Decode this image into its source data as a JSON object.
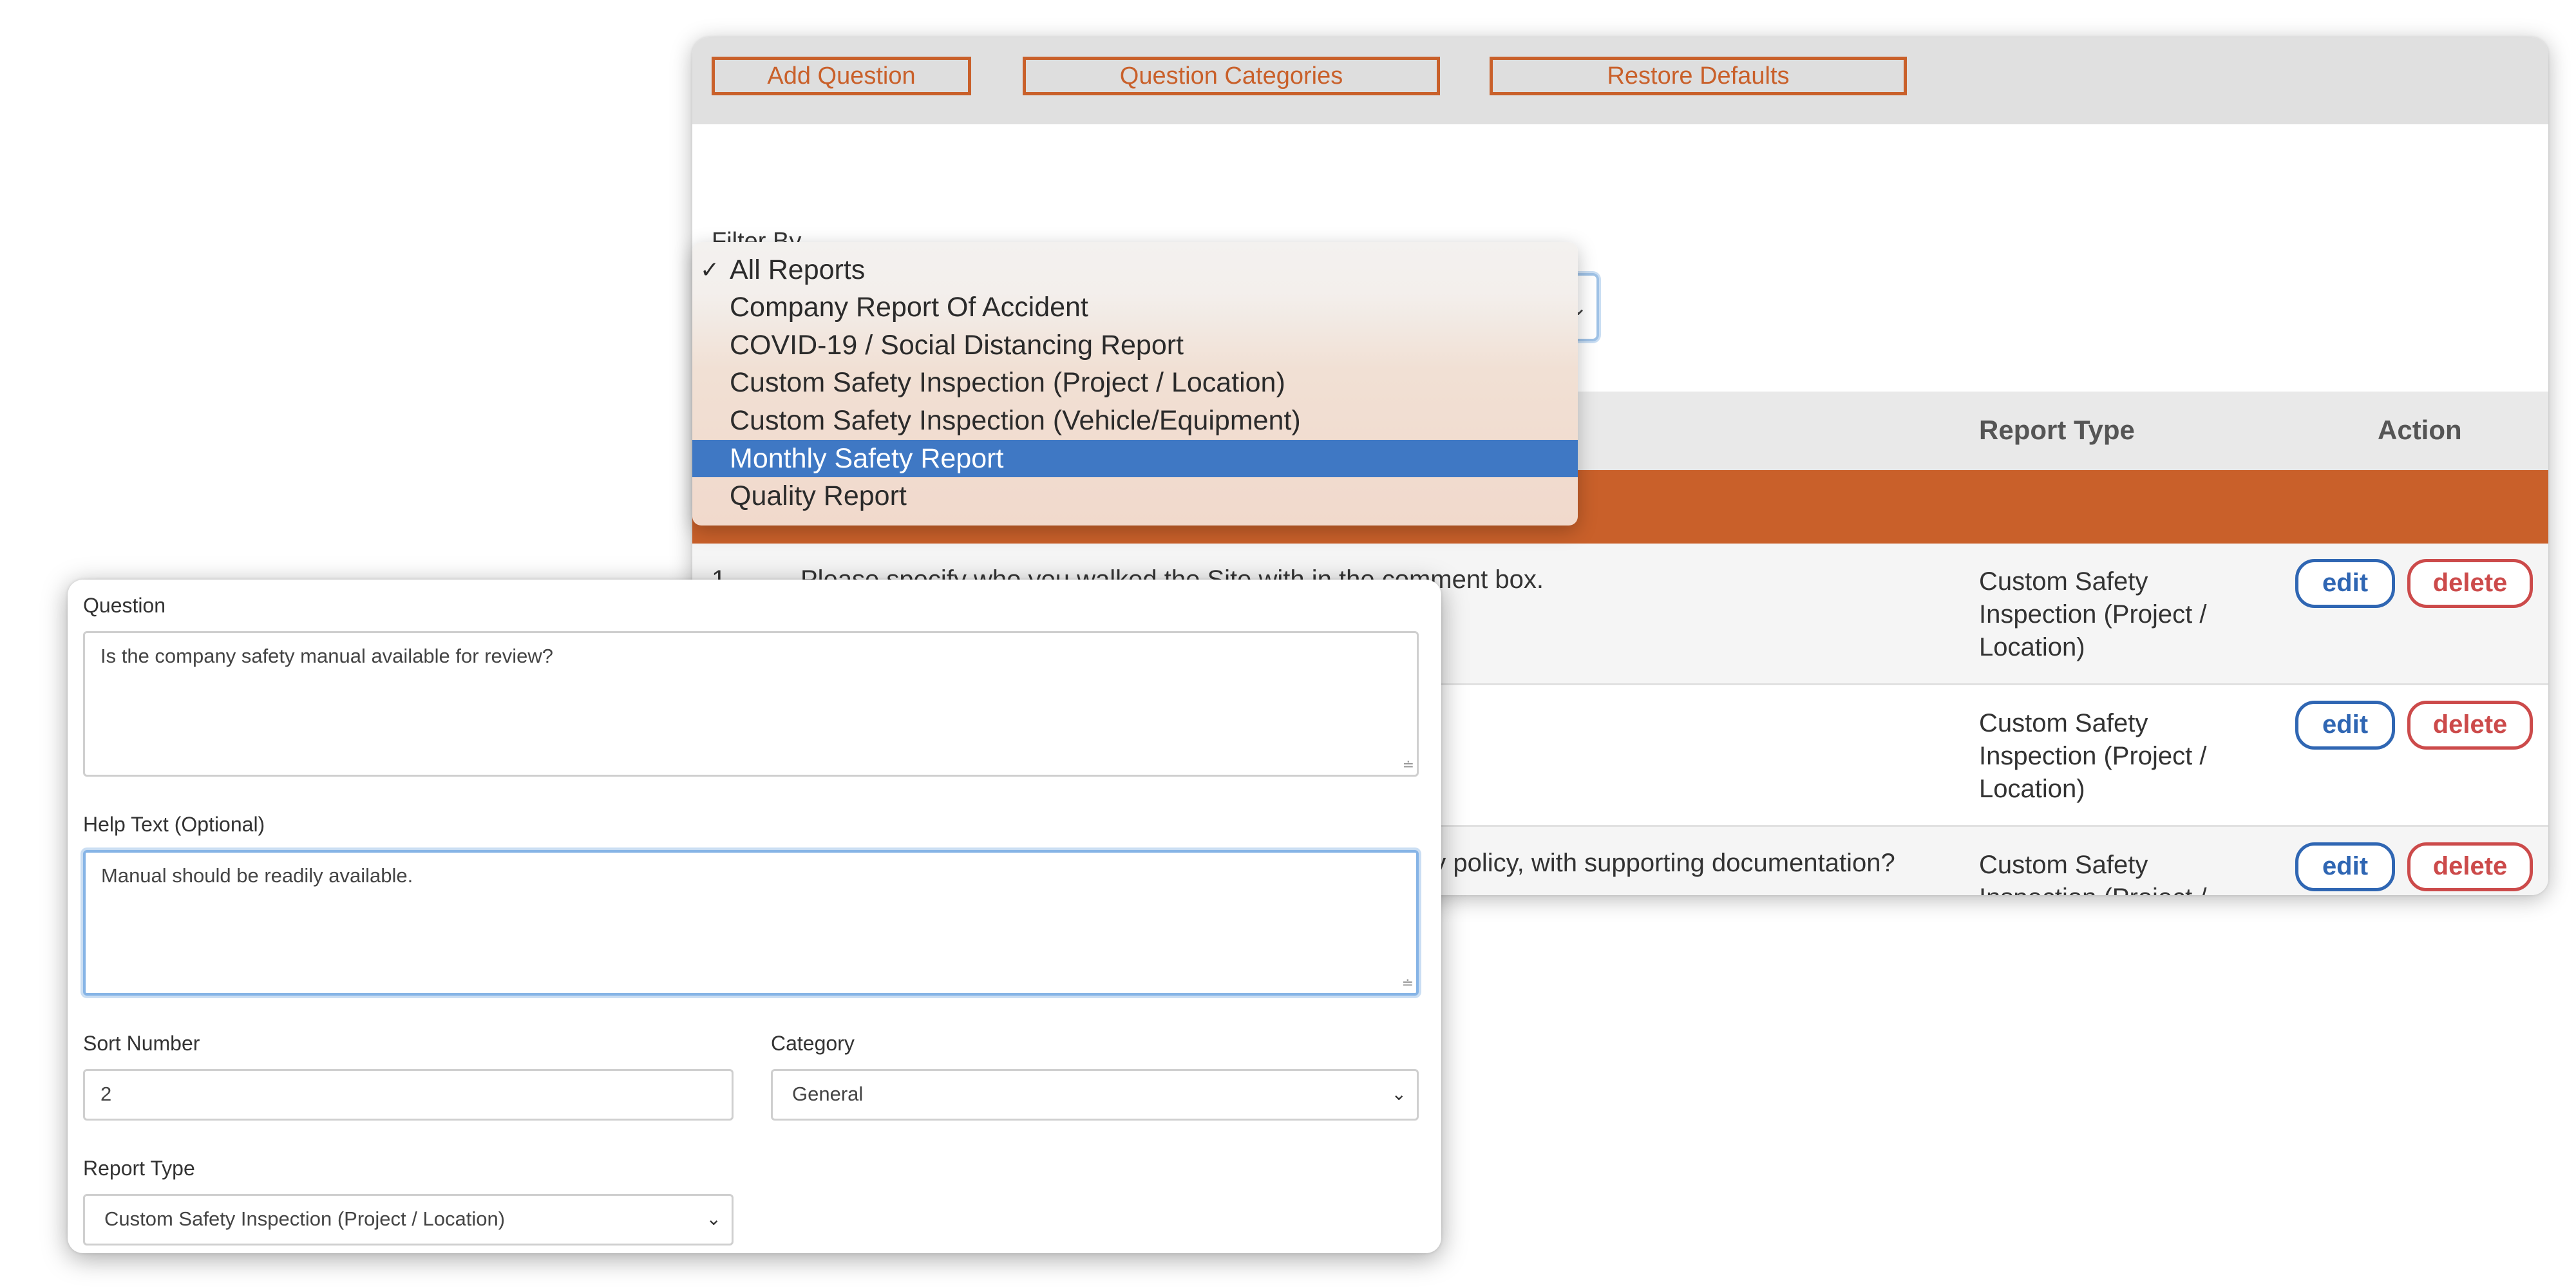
{
  "toolbar": {
    "add_question": "Add Question",
    "question_categories": "Question Categories",
    "restore_defaults": "Restore Defaults"
  },
  "filter": {
    "label": "Filter By",
    "selected": "All Reports",
    "options": [
      "All Reports",
      "Company Report Of Accident",
      "COVID-19 / Social Distancing Report",
      "Custom Safety Inspection (Project / Location)",
      "Custom Safety Inspection (Vehicle/Equipment)",
      "Monthly Safety Report",
      "Quality Report"
    ],
    "highlighted": "Monthly Safety Report"
  },
  "table": {
    "headers": {
      "report_type": "Report Type",
      "action": "Action"
    },
    "rows": [
      {
        "number": "1.",
        "question": "Please specify who you walked the Site with in the comment box.",
        "report_type": "Custom Safety Inspection (Project / Location)"
      },
      {
        "number": "",
        "question": "",
        "report_type": "Custom Safety Inspection (Project / Location)"
      },
      {
        "number": "",
        "question": "ny policy, with supporting documentation?",
        "report_type": "Custom Safety Inspection (Project / Location)"
      }
    ],
    "edit_label": "edit",
    "delete_label": "delete"
  },
  "form": {
    "question_label": "Question",
    "question_value": "Is the company safety manual available for review?",
    "help_label": "Help Text (Optional)",
    "help_value": "Manual should be readily available.",
    "sort_label": "Sort Number",
    "sort_value": "2",
    "category_label": "Category",
    "category_value": "General",
    "report_type_label": "Report Type",
    "report_type_value": "Custom Safety Inspection (Project / Location)"
  },
  "colors": {
    "accent_orange": "#c9602a",
    "edit_blue": "#2f66b3",
    "delete_red": "#cc4a4a",
    "highlight_blue": "#3f78c4"
  }
}
